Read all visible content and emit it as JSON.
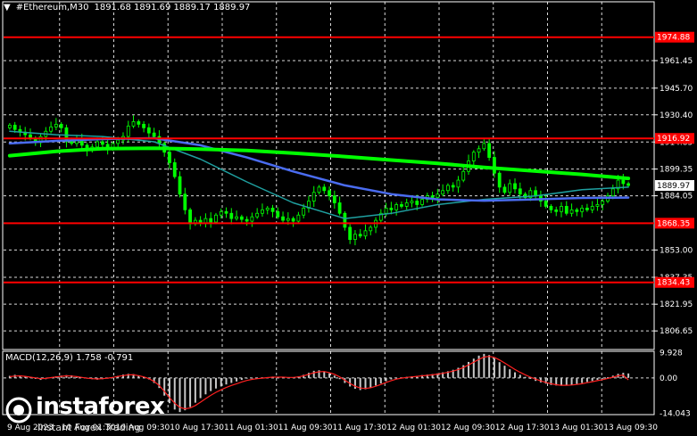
{
  "header": {
    "symbol": "#Ethereum,M30",
    "ohlc": "1891.68 1891.69 1889.17 1889.97"
  },
  "colors": {
    "background": "#000000",
    "candle": "#00ff00",
    "ma_fast": "#00ff00",
    "ma_mid": "#4a6cf0",
    "ma_slow": "#1fa0a0",
    "level_line": "#ff0000",
    "macd_hist": "#c8c8c8",
    "macd_signal": "#ff2020",
    "grid": "#ffffff"
  },
  "chart_data": [
    {
      "type": "candlestick",
      "title": "#Ethereum,M30",
      "ylim": [
        1796,
        1988
      ],
      "y_ticks": [
        "1961.45",
        "1945.70",
        "1930.40",
        "1914.85",
        "1899.35",
        "1884.05",
        "1853.00",
        "1837.35",
        "1821.95",
        "1806.65"
      ],
      "levels": [
        {
          "value": 1974.88,
          "label": "1974.88"
        },
        {
          "value": 1916.92,
          "label": "1916.92"
        },
        {
          "value": 1868.35,
          "label": "1868.35"
        },
        {
          "value": 1834.43,
          "label": "1834.43"
        }
      ],
      "current_price": {
        "value": 1889.97,
        "label": "1889.97"
      },
      "x_labels": [
        "9 Aug 2023",
        "10 Aug 01:30",
        "10 Aug 09:30",
        "10 Aug 17:30",
        "11 Aug 01:30",
        "11 Aug 09:30",
        "11 Aug 17:30",
        "12 Aug 01:30",
        "12 Aug 09:30",
        "12 Aug 17:30",
        "13 Aug 01:30",
        "13 Aug 09:30"
      ],
      "close": [
        1924.5,
        1922.0,
        1920.5,
        1919.0,
        1917.0,
        1914.5,
        1918.0,
        1921.0,
        1923.5,
        1925.0,
        1923.0,
        1915.0,
        1914.0,
        1916.0,
        1913.0,
        1910.0,
        1912.0,
        1915.0,
        1913.5,
        1911.0,
        1914.0,
        1916.0,
        1918.0,
        1924.0,
        1926.5,
        1925.0,
        1923.0,
        1920.0,
        1918.0,
        1914.0,
        1909.0,
        1903.0,
        1895.0,
        1885.0,
        1876.0,
        1868.0,
        1870.0,
        1868.5,
        1871.0,
        1869.0,
        1873.0,
        1875.0,
        1874.0,
        1871.0,
        1872.0,
        1870.5,
        1869.5,
        1872.0,
        1874.0,
        1876.0,
        1877.0,
        1875.0,
        1872.0,
        1870.0,
        1871.0,
        1869.5,
        1873.0,
        1877.0,
        1881.0,
        1886.0,
        1889.0,
        1887.0,
        1884.0,
        1880.0,
        1874.0,
        1866.0,
        1859.0,
        1862.0,
        1861.0,
        1864.0,
        1866.0,
        1870.0,
        1874.0,
        1877.0,
        1876.0,
        1879.0,
        1878.0,
        1880.0,
        1881.0,
        1879.0,
        1882.0,
        1884.0,
        1883.0,
        1885.0,
        1887.0,
        1890.0,
        1889.0,
        1893.0,
        1898.0,
        1904.0,
        1909.0,
        1911.0,
        1914.0,
        1906.0,
        1897.0,
        1889.0,
        1886.0,
        1891.0,
        1888.0,
        1885.0,
        1883.0,
        1887.0,
        1884.0,
        1881.0,
        1878.0,
        1876.0,
        1875.0,
        1878.0,
        1874.0,
        1876.0,
        1875.0,
        1877.0,
        1876.0,
        1878.0,
        1879.0,
        1881.0,
        1884.0,
        1888.0,
        1893.0,
        1891.0,
        1889.97
      ],
      "ma_fast": [
        1907.0,
        1909.5,
        1911.0,
        1911.3,
        1910.8,
        1910.0,
        1908.5,
        1906.5,
        1904.5,
        1902.6,
        1900.3,
        1898.2,
        1896.3,
        1894.0
      ],
      "ma_mid": [
        1914.0,
        1915.5,
        1916.5,
        1917.0,
        1913.0,
        1906.0,
        1898.0,
        1890.0,
        1885.0,
        1882.0,
        1881.2,
        1882.0,
        1882.8,
        1883.0
      ],
      "ma_slow": [
        1921.0,
        1919.0,
        1918.0,
        1915.0,
        1905.0,
        1892.0,
        1880.0,
        1871.0,
        1874.0,
        1879.0,
        1882.0,
        1884.0,
        1887.5,
        1889.0
      ]
    },
    {
      "type": "bar",
      "title": "MACD(12,26,9)",
      "params": "1.758 -0.791",
      "ylim": [
        -14.5,
        10.5
      ],
      "y_ticks": [
        "9.928",
        "0.00",
        "-14.043"
      ],
      "histogram": [
        0.8,
        1.2,
        0.9,
        0.5,
        0.3,
        -0.4,
        -0.8,
        -0.5,
        0.2,
        0.6,
        0.9,
        1.1,
        1.0,
        0.6,
        0.3,
        -0.2,
        -0.5,
        -0.7,
        -0.5,
        -0.2,
        0.3,
        0.8,
        1.3,
        1.6,
        1.5,
        1.0,
        0.4,
        -0.6,
        -2.0,
        -4.0,
        -7.0,
        -10.0,
        -12.5,
        -13.5,
        -12.8,
        -11.5,
        -9.8,
        -8.0,
        -6.5,
        -5.2,
        -4.2,
        -3.4,
        -2.6,
        -2.0,
        -1.4,
        -0.8,
        -0.3,
        -0.1,
        0.0,
        0.2,
        0.3,
        0.5,
        0.4,
        0.2,
        0.1,
        0.2,
        0.6,
        1.2,
        2.0,
        2.8,
        3.0,
        2.6,
        1.8,
        0.9,
        -0.5,
        -2.0,
        -3.4,
        -4.3,
        -4.8,
        -4.5,
        -3.8,
        -3.0,
        -2.2,
        -1.3,
        -0.6,
        -0.1,
        0.2,
        0.4,
        0.6,
        0.8,
        1.1,
        1.3,
        1.5,
        1.8,
        2.2,
        2.6,
        3.2,
        4.0,
        5.0,
        6.3,
        7.6,
        8.8,
        9.5,
        9.0,
        7.8,
        6.2,
        4.8,
        3.4,
        2.2,
        1.2,
        0.4,
        -0.4,
        -1.2,
        -1.8,
        -2.3,
        -2.8,
        -3.0,
        -3.1,
        -3.0,
        -2.7,
        -2.4,
        -2.0,
        -1.6,
        -1.2,
        -0.8,
        -0.3,
        0.3,
        0.9,
        1.6,
        2.0,
        1.758
      ],
      "signal": [
        0.5,
        0.7,
        0.8,
        0.6,
        0.3,
        0.0,
        -0.3,
        -0.2,
        0.1,
        0.4,
        0.6,
        0.8,
        0.7,
        0.5,
        0.2,
        -0.1,
        -0.3,
        -0.4,
        -0.3,
        -0.1,
        0.2,
        0.6,
        0.9,
        1.2,
        1.2,
        0.9,
        0.4,
        -0.3,
        -1.4,
        -3.0,
        -5.3,
        -7.8,
        -10.0,
        -11.6,
        -12.2,
        -11.9,
        -10.9,
        -9.6,
        -8.2,
        -6.9,
        -5.7,
        -4.7,
        -3.8,
        -3.0,
        -2.3,
        -1.6,
        -1.0,
        -0.6,
        -0.3,
        -0.1,
        0.1,
        0.3,
        0.3,
        0.3,
        0.2,
        0.2,
        0.4,
        0.8,
        1.4,
        2.0,
        2.4,
        2.5,
        2.1,
        1.4,
        0.4,
        -0.9,
        -2.2,
        -3.3,
        -4.0,
        -4.2,
        -3.9,
        -3.3,
        -2.6,
        -1.8,
        -1.1,
        -0.5,
        -0.1,
        0.2,
        0.4,
        0.6,
        0.8,
        1.0,
        1.2,
        1.5,
        1.8,
        2.2,
        2.7,
        3.3,
        4.1,
        5.1,
        6.2,
        7.3,
        8.2,
        8.5,
        8.1,
        7.1,
        5.9,
        4.6,
        3.3,
        2.2,
        1.2,
        0.3,
        -0.5,
        -1.2,
        -1.8,
        -2.3,
        -2.7,
        -2.9,
        -2.9,
        -2.8,
        -2.6,
        -2.3,
        -1.9,
        -1.5,
        -1.1,
        -0.7,
        -0.2,
        0.3,
        0.8,
        1.1,
        -0.791
      ]
    }
  ],
  "logo": {
    "name": "instaforex",
    "tagline": "Instant Forex Trading"
  }
}
